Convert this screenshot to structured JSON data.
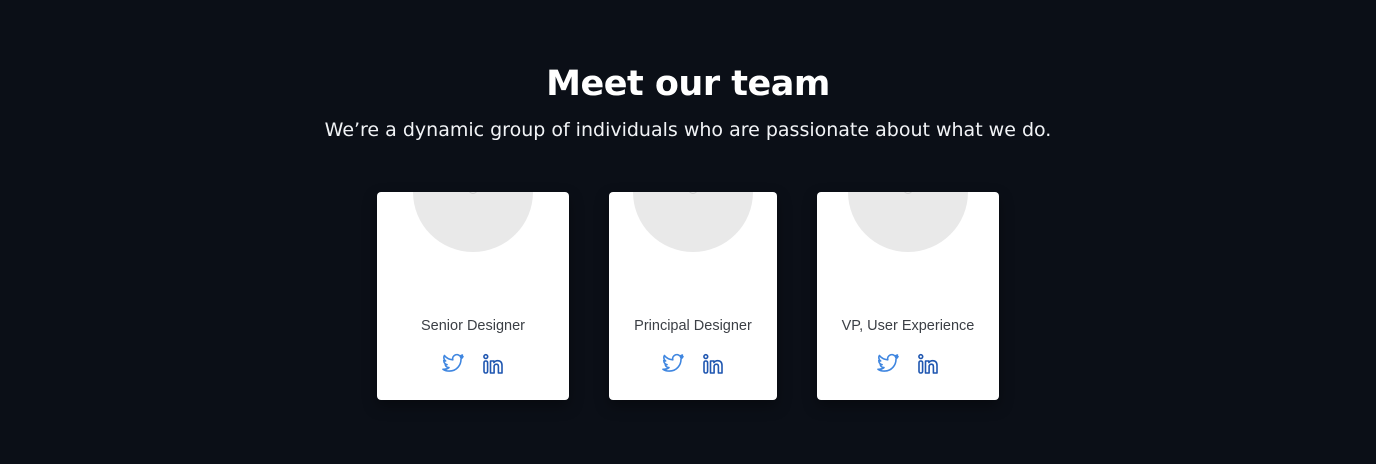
{
  "header": {
    "title": "Meet our team",
    "subtitle": "We’re a dynamic group of individuals who are passionate about what we do."
  },
  "team": [
    {
      "role": "Senior Designer",
      "socials": [
        {
          "icon": "twitter-icon",
          "label": "Twitter"
        },
        {
          "icon": "linkedin-icon",
          "label": "LinkedIn"
        }
      ]
    },
    {
      "role": "Principal Designer",
      "socials": [
        {
          "icon": "twitter-icon",
          "label": "Twitter"
        },
        {
          "icon": "linkedin-icon",
          "label": "LinkedIn"
        }
      ]
    },
    {
      "role": "VP, User Experience",
      "socials": [
        {
          "icon": "twitter-icon",
          "label": "Twitter"
        },
        {
          "icon": "linkedin-icon",
          "label": "LinkedIn"
        }
      ]
    }
  ],
  "colors": {
    "background": "#0b0f17",
    "card": "#ffffff",
    "avatar_placeholder": "#e9e9e9",
    "twitter": "#3f86e0",
    "linkedin": "#1f56b0"
  }
}
